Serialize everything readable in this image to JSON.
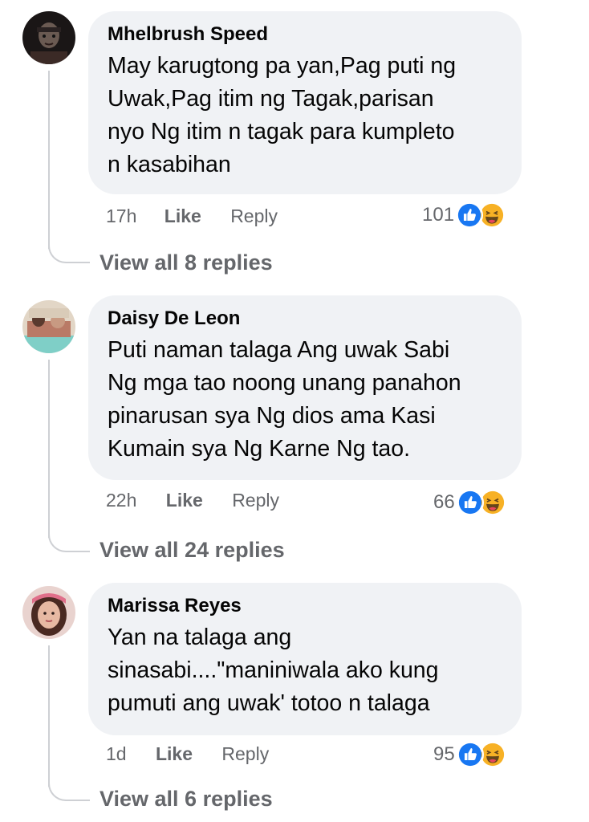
{
  "comments": [
    {
      "author": "Mhelbrush Speed",
      "text": "May karugtong pa yan,Pag puti ng\nUwak,Pag itim ng Tagak,parisan\nnyo Ng itim n tagak para kumpleto\nn kasabihan",
      "time": "17h",
      "like_label": "Like",
      "reply_label": "Reply",
      "reaction_count": "101",
      "reaction_icons": [
        "like-icon",
        "haha-icon"
      ],
      "view_replies": "View all 8 replies"
    },
    {
      "author": "Daisy De Leon",
      "text": "Puti naman talaga Ang uwak Sabi\nNg mga tao noong unang panahon\npinarusan sya Ng dios ama Kasi\nKumain sya Ng Karne Ng tao.",
      "time": "22h",
      "like_label": "Like",
      "reply_label": "Reply",
      "reaction_count": "66",
      "reaction_icons": [
        "like-icon",
        "haha-icon"
      ],
      "view_replies": "View all 24 replies"
    },
    {
      "author": "Marissa Reyes",
      "text": "Yan na talaga ang\nsinasabi....\"maniniwala ako kung\npumuti ang uwak' totoo n talaga",
      "time": "1d",
      "like_label": "Like",
      "reply_label": "Reply",
      "reaction_count": "95",
      "reaction_icons": [
        "like-icon",
        "haha-icon"
      ],
      "view_replies": "View all 6 replies"
    }
  ],
  "colors": {
    "bubble_bg": "#f0f2f5",
    "secondary_text": "#65676b",
    "like_blue": "#1877f2",
    "haha_yellow": "#f7b125",
    "thread_line": "#ced0d4"
  }
}
